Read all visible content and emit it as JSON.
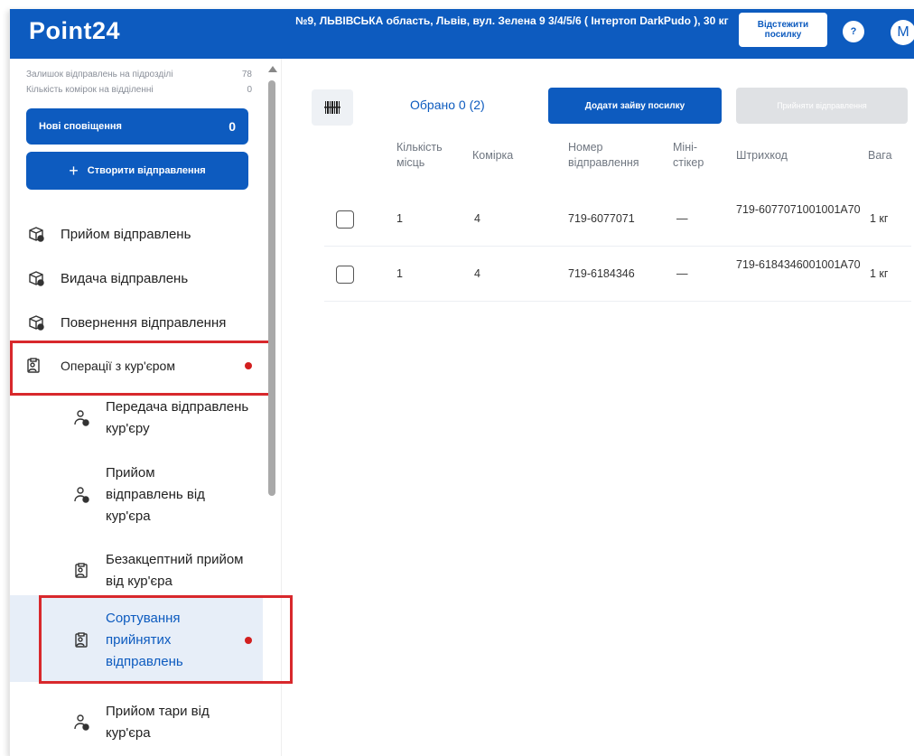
{
  "header": {
    "logo": "Point24",
    "address": "№9, ЛЬВІВСЬКА область, Львів, вул. Зелена 9 3/4/5/6 ( Інтертоп DarkPudo ), 30 кг",
    "track_button": "Відстежити посилку",
    "help_label": "?",
    "avatar_letter": "M",
    "brand_color": "#0d5bbf"
  },
  "sidebar": {
    "stats": [
      {
        "label": "Залишок відправлень на підрозділі",
        "value": "78"
      },
      {
        "label": "Кількість комірок на відділенні",
        "value": "0"
      }
    ],
    "notifications_label": "Нові сповіщення",
    "notifications_count": "0",
    "create_label": "Створити відправлення",
    "create_plus": "+",
    "items": [
      {
        "label": "Прийом відправлень",
        "icon": "parcel-icon"
      },
      {
        "label": "Видача відправлень",
        "icon": "parcel-icon"
      },
      {
        "label": "Повернення відправлення",
        "icon": "parcel-icon"
      },
      {
        "label": "Операції з кур'єром",
        "icon": "courier-clipboard-icon"
      }
    ],
    "sub_items": [
      {
        "label": "Передача відправлень кур'єру",
        "icon": "courier-icon"
      },
      {
        "label": "Прийом відправлень від кур'єра",
        "icon": "courier-icon"
      },
      {
        "label": "Безакцептний прийом від кур'єра",
        "icon": "courier-clipboard-icon"
      },
      {
        "label": "Сортування прийнятих відправлень",
        "icon": "courier-clipboard-icon"
      },
      {
        "label": "Прийом тари від кур'єра",
        "icon": "courier-icon"
      }
    ]
  },
  "toolbar": {
    "selected": "Обрано 0 (2)",
    "add_extra": "Додати зайву посилку",
    "accept": "Прийняти відправлення"
  },
  "table": {
    "headers": [
      "Кількість місць",
      "Комірка",
      "Номер відправлення",
      "Міні-стікер",
      "Штрихкод",
      "Вага"
    ],
    "rows": [
      {
        "places": "1",
        "cell": "4",
        "number": "719-6077071",
        "sticker": "—",
        "barcode": "719-6077071001001A70",
        "weight": "1 кг"
      },
      {
        "places": "1",
        "cell": "4",
        "number": "719-6184346",
        "sticker": "—",
        "barcode": "719-6184346001001A70",
        "weight": "1 кг"
      }
    ]
  },
  "colors": {
    "highlight": "#d8282c",
    "dot": "#d21f1f",
    "active_bg": "#e7eef8"
  }
}
